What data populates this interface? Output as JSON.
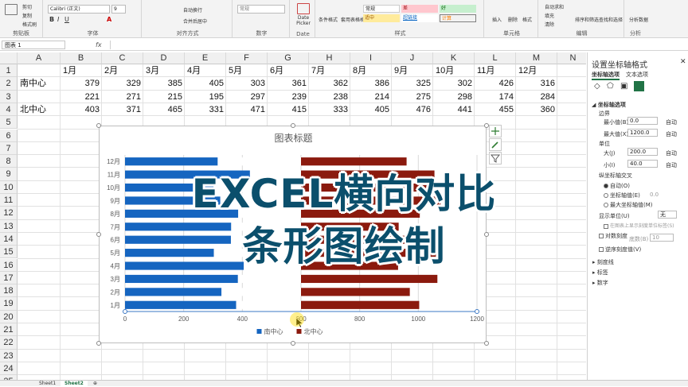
{
  "ribbon": {
    "clipboard": {
      "label": "剪贴板",
      "cut": "剪切",
      "copy": "复制",
      "painter": "格式刷"
    },
    "font": {
      "label": "字体",
      "name": "Calibri (正文)",
      "size": "9"
    },
    "alignment": {
      "label": "对齐方式",
      "wrap": "自动换行",
      "merge": "合并后居中"
    },
    "number": {
      "label": "数字",
      "format": "常规"
    },
    "date": {
      "label": "Date",
      "picker": "Date Picker"
    },
    "styles": {
      "label": "样式",
      "cond_format": "条件格式",
      "table_format": "套用表格格式",
      "cells": [
        "常规",
        "差",
        "好",
        "适中",
        "超链接",
        "计算"
      ]
    },
    "cells_group": {
      "label": "单元格",
      "insert": "插入",
      "delete": "删除",
      "format": "格式"
    },
    "editing": {
      "label": "编辑",
      "autosum": "自动求和",
      "fill": "填充",
      "clear": "清除",
      "sort": "排序和筛选",
      "find": "查找和选择"
    },
    "analysis": {
      "label": "分析",
      "analyze": "分析数据"
    }
  },
  "formula_bar": {
    "name_box": "图表 1",
    "fx": "fx"
  },
  "sheet": {
    "columns": [
      "A",
      "B",
      "C",
      "D",
      "E",
      "F",
      "G",
      "H",
      "I",
      "J",
      "K",
      "L",
      "M",
      "N"
    ],
    "rows": [
      "1",
      "2",
      "3",
      "4",
      "5",
      "6",
      "7",
      "8",
      "9",
      "10",
      "11",
      "12",
      "13",
      "14",
      "15",
      "16",
      "17",
      "18",
      "19",
      "20",
      "21",
      "22",
      "23",
      "24",
      "25"
    ],
    "header_row": [
      "",
      "1月",
      "2月",
      "3月",
      "4月",
      "5月",
      "6月",
      "7月",
      "8月",
      "9月",
      "10月",
      "11月",
      "12月"
    ],
    "data_rows": [
      {
        "label": "南中心",
        "values": [
          379,
          329,
          385,
          405,
          303,
          361,
          362,
          386,
          325,
          302,
          426,
          316
        ]
      },
      {
        "label": "",
        "values": [
          221,
          271,
          215,
          195,
          297,
          239,
          238,
          214,
          275,
          298,
          174,
          284
        ]
      },
      {
        "label": "北中心",
        "values": [
          403,
          371,
          465,
          331,
          471,
          415,
          333,
          405,
          476,
          441,
          455,
          360
        ]
      }
    ]
  },
  "chart_data": {
    "type": "bar",
    "orientation": "horizontal",
    "stacked": true,
    "title": "图表标题",
    "categories": [
      "1月",
      "2月",
      "3月",
      "4月",
      "5月",
      "6月",
      "7月",
      "8月",
      "9月",
      "10月",
      "11月",
      "12月"
    ],
    "series": [
      {
        "name": "南中心",
        "color": "#1565c0",
        "values": [
          379,
          329,
          385,
          405,
          303,
          361,
          362,
          386,
          325,
          302,
          426,
          316
        ]
      },
      {
        "name": "",
        "color": "#ffffff",
        "values": [
          221,
          271,
          215,
          195,
          297,
          239,
          238,
          214,
          275,
          298,
          174,
          284
        ]
      },
      {
        "name": "北中心",
        "color": "#8b1a0e",
        "values": [
          403,
          371,
          465,
          331,
          471,
          415,
          333,
          405,
          476,
          441,
          455,
          360
        ]
      }
    ],
    "xlim": [
      0,
      1200
    ],
    "xticks": [
      "0",
      "200",
      "400",
      "600",
      "800",
      "1000",
      "1200"
    ],
    "grid": true,
    "legend": "bottom"
  },
  "pane": {
    "title": "设置坐标轴格式",
    "tab1": "坐标轴选项",
    "tab2": "文本选项",
    "section": "坐标轴选项",
    "bounds": "边界",
    "min_label": "最小值(B)",
    "min_val": "0.0",
    "max_label": "最大值(X)",
    "max_val": "1200.0",
    "auto": "自动",
    "units": "单位",
    "major_label": "大(J)",
    "major_val": "200.0",
    "minor_label": "小(I)",
    "minor_val": "40.0",
    "cross": "纵坐标轴交叉",
    "cross_auto": "自动(O)",
    "cross_value": "坐标轴值(E)",
    "cross_value_num": "0.0",
    "cross_max": "最大坐标轴值(M)",
    "display_units": "显示单位(U)",
    "display_units_val": "无",
    "show_label": "在图表上显示刻度单位标签(S)",
    "log": "对数刻度",
    "log_base_label": "底数(B)",
    "log_base_val": "10",
    "reverse": "逆序刻度值(V)",
    "ticks": "刻度线",
    "labels": "标签",
    "number": "数字"
  },
  "tabs": [
    "Sheet1",
    "Sheet2"
  ],
  "overlay": {
    "line1": "EXCEL横向对比",
    "line2": "条形图绘制"
  }
}
